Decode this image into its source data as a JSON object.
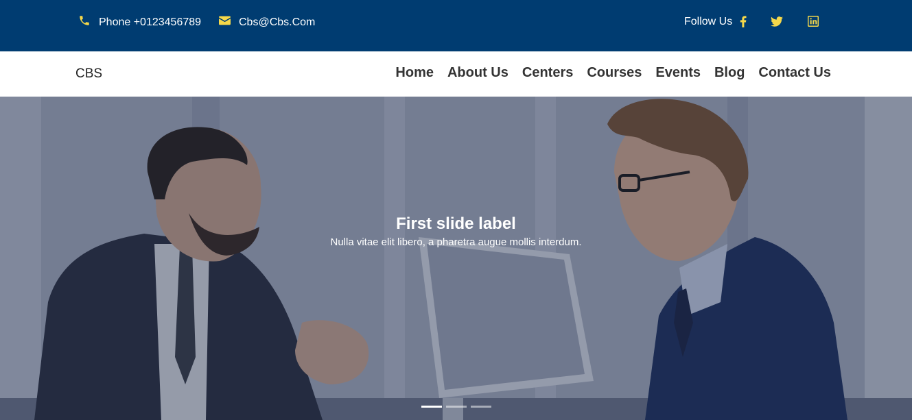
{
  "topbar": {
    "phone": "Phone +0123456789",
    "email": "Cbs@Cbs.Com",
    "follow_label": "Follow Us",
    "social": [
      "facebook-icon",
      "twitter-icon",
      "linkedin-icon"
    ],
    "icon_color": "#f5d84a",
    "background": "#003c71"
  },
  "navbar": {
    "brand": "CBS",
    "links": [
      "Home",
      "About Us",
      "Centers",
      "Courses",
      "Events",
      "Blog",
      "Contact Us"
    ]
  },
  "hero": {
    "title": "First slide label",
    "subtitle": "Nulla vitae elit libero, a pharetra augue mollis interdum.",
    "slide_count": 3,
    "active_slide": 1
  }
}
